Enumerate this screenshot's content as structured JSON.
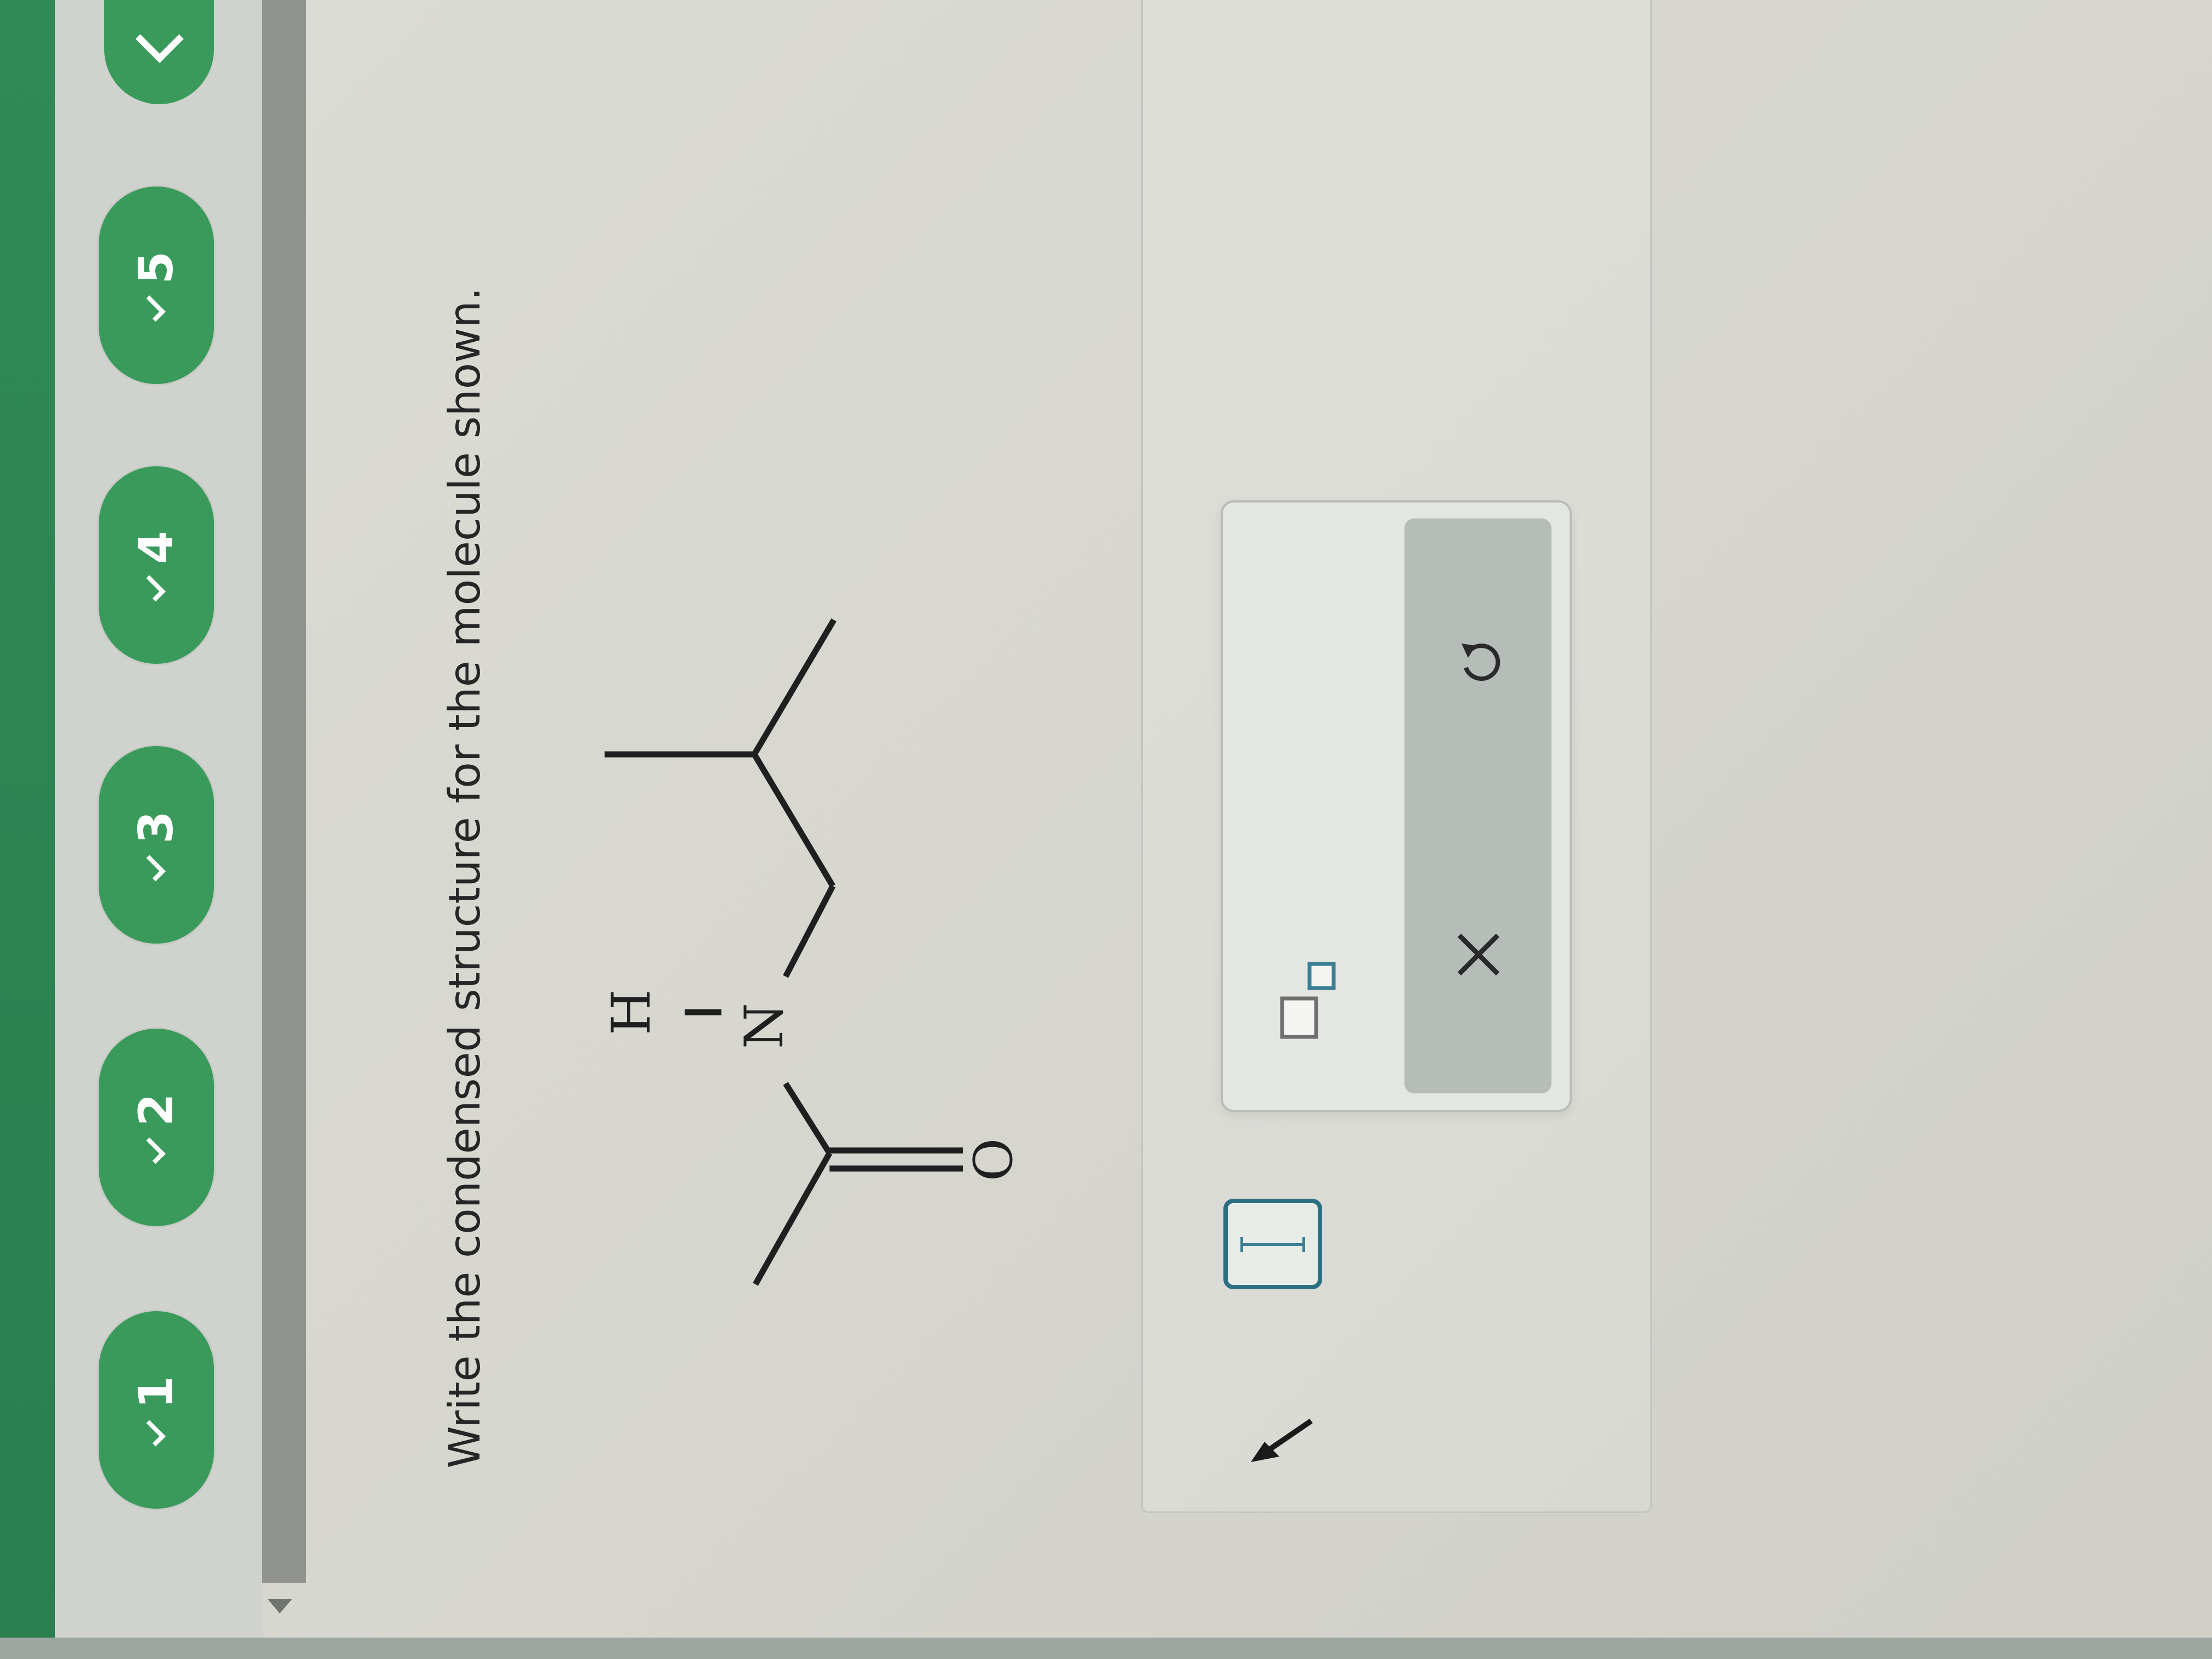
{
  "steps": [
    {
      "number": "1",
      "state": "done"
    },
    {
      "number": "2",
      "state": "done"
    },
    {
      "number": "3",
      "state": "done"
    },
    {
      "number": "4",
      "state": "done"
    },
    {
      "number": "5",
      "state": "done"
    }
  ],
  "question": {
    "prompt": "Write the condensed structure for the molecule shown."
  },
  "molecule": {
    "atoms": {
      "h_label": "H",
      "n_label": "N",
      "o_label": "O"
    }
  },
  "toolbox": {
    "superscript_icon": "superscript-icon",
    "clear_icon": "close-icon",
    "undo_icon": "undo-icon"
  },
  "colors": {
    "accent_green": "#3a9a5c",
    "dark_green": "#2a7f4e",
    "input_border": "#2c6f82",
    "action_strip": "#b6bcb8"
  }
}
